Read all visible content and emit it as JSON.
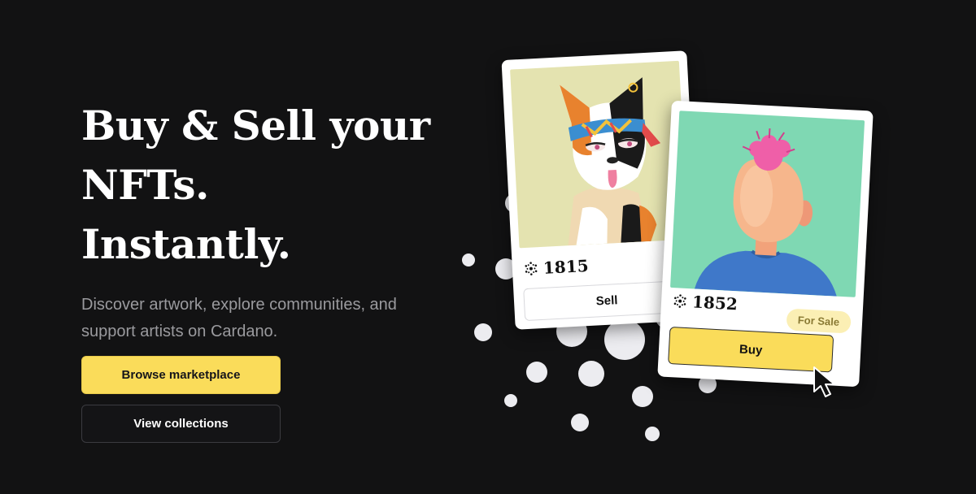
{
  "hero": {
    "headline_lines": [
      "Buy & Sell your",
      "NFTs.",
      "Instantly."
    ],
    "subtitle": "Discover artwork, explore communities, and support artists on Cardano.",
    "primary_button": "Browse marketplace",
    "secondary_button": "View collections"
  },
  "cards": [
    {
      "price": "1815",
      "action": "Sell",
      "art": "cat-nft",
      "currency_icon": "cardano-icon"
    },
    {
      "price": "1852",
      "action": "Buy",
      "badge": "For Sale",
      "art": "figure-nft",
      "currency_icon": "cardano-icon"
    }
  ],
  "colors": {
    "background": "#121213",
    "accent": "#fadc5a",
    "subtitle": "#9a9a9e",
    "badge_bg": "#fbefb4"
  }
}
